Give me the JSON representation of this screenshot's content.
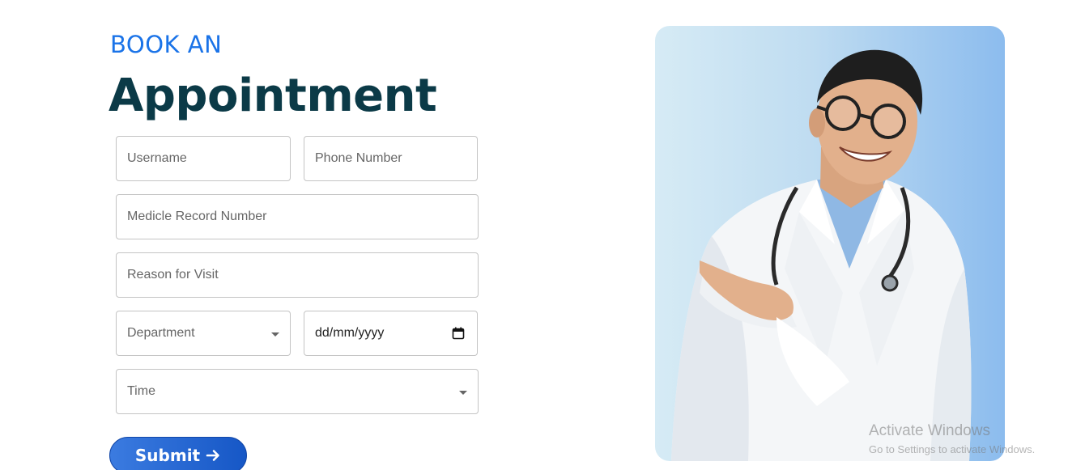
{
  "header": {
    "kicker": "BOOK AN",
    "title": "Appointment"
  },
  "form": {
    "username": {
      "placeholder": "Username"
    },
    "phone": {
      "placeholder": "Phone Number"
    },
    "record": {
      "placeholder": "Medicle Record Number"
    },
    "reason": {
      "placeholder": "Reason for Visit"
    },
    "department": {
      "placeholder": "Department"
    },
    "date": {
      "value": "dd/mm/yyyy"
    },
    "time": {
      "placeholder": "Time"
    },
    "submit_label": "Submit"
  },
  "icons": {
    "submit_arrow": "arrow-right-icon",
    "department_caret": "chevron-down-icon",
    "time_caret": "chevron-down-icon",
    "date_picker": "calendar-icon"
  },
  "watermark": {
    "title": "Activate Windows",
    "subtitle": "Go to Settings to activate Windows."
  },
  "colors": {
    "accent": "#1a73e8",
    "heading": "#0b3a47",
    "button": "#1657c6"
  }
}
